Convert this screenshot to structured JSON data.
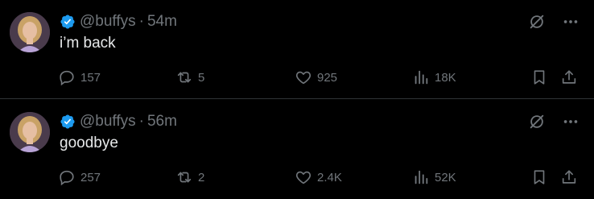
{
  "colors": {
    "background": "#000000",
    "text_primary": "#e7e9ea",
    "text_secondary": "#71767b",
    "verified": "#1d9bf0",
    "divider": "#2f3336"
  },
  "tweets": [
    {
      "handle": "@buffys",
      "separator": "·",
      "time": "54m",
      "text": "i’m back",
      "replies": "157",
      "reposts": "5",
      "likes": "925",
      "views": "18K"
    },
    {
      "handle": "@buffys",
      "separator": "·",
      "time": "56m",
      "text": "goodbye",
      "replies": "257",
      "reposts": "2",
      "likes": "2.4K",
      "views": "52K"
    }
  ],
  "icons": {
    "verified": "verified-badge-icon",
    "grok": "grok-icon",
    "more": "more-icon",
    "reply": "reply-icon",
    "repost": "repost-icon",
    "like": "heart-icon",
    "views": "views-icon",
    "bookmark": "bookmark-icon",
    "share": "share-icon"
  }
}
